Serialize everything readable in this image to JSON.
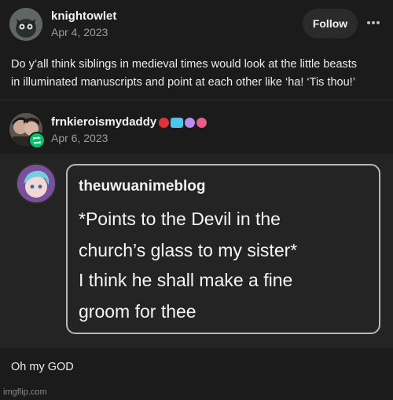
{
  "post": {
    "author": "knightowlet",
    "date": "Apr 4, 2023",
    "follow_label": "Follow",
    "body_line1": "Do y’all think siblings in medieval times would look at the little beasts",
    "body_line2": "in illuminated manuscripts and point at each other like ‘ha! ‘Tis thou!’"
  },
  "reblog": {
    "author": "frnkieroismydaddy",
    "date": "Apr 6, 2023",
    "badge_colors": [
      "#e0323c",
      "#4fc3e8",
      "#b98cf0",
      "#e85c8c"
    ]
  },
  "quoted": {
    "author": "theuwuanimeblog",
    "lines": [
      "*Points to the Devil in the",
      "church’s glass to my sister*",
      "I think he shall make a fine",
      "groom for thee"
    ]
  },
  "comment": "Oh my GOD",
  "watermark": "imgflip.com",
  "colors": {
    "background": "#1b1b1b",
    "reblog_green": "#00c46a",
    "follow_button": "#2b2b2b"
  }
}
